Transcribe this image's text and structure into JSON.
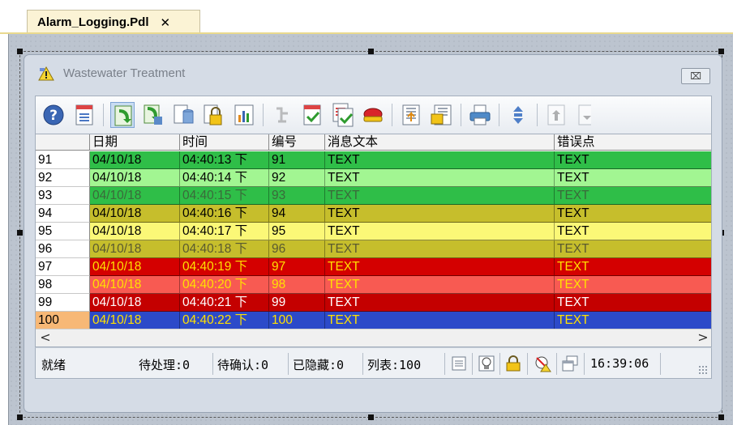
{
  "tab": {
    "title": "Alarm_Logging.Pdl",
    "close": "✕"
  },
  "window": {
    "title": "Wastewater Treatment",
    "close": "⌧"
  },
  "table": {
    "columns": [
      "",
      "日期",
      "时间",
      "编号",
      "消息文本",
      "错误点"
    ],
    "rows": [
      {
        "n": "91",
        "date": "04/10/18",
        "time": "04:40:13 下",
        "id": "91",
        "msg": "TEXT",
        "err": "TEXT",
        "bg": "#2fbe48",
        "fg": "#000000",
        "numbg": "#ffffff"
      },
      {
        "n": "92",
        "date": "04/10/18",
        "time": "04:40:14 下",
        "id": "92",
        "msg": "TEXT",
        "err": "TEXT",
        "bg": "#a2f692",
        "fg": "#000000",
        "numbg": "#ffffff"
      },
      {
        "n": "93",
        "date": "04/10/18",
        "time": "04:40:15 下",
        "id": "93",
        "msg": "TEXT",
        "err": "TEXT",
        "bg": "#2fbe48",
        "fg": "#3a6a3a",
        "numbg": "#ffffff"
      },
      {
        "n": "94",
        "date": "04/10/18",
        "time": "04:40:16 下",
        "id": "94",
        "msg": "TEXT",
        "err": "TEXT",
        "bg": "#c6be2c",
        "fg": "#000000",
        "numbg": "#ffffff"
      },
      {
        "n": "95",
        "date": "04/10/18",
        "time": "04:40:17 下",
        "id": "95",
        "msg": "TEXT",
        "err": "TEXT",
        "bg": "#fbf877",
        "fg": "#000000",
        "numbg": "#ffffff"
      },
      {
        "n": "96",
        "date": "04/10/18",
        "time": "04:40:18 下",
        "id": "96",
        "msg": "TEXT",
        "err": "TEXT",
        "bg": "#c6be2c",
        "fg": "#5a5a30",
        "numbg": "#ffffff"
      },
      {
        "n": "97",
        "date": "04/10/18",
        "time": "04:40:19 下",
        "id": "97",
        "msg": "TEXT",
        "err": "TEXT",
        "bg": "#d40000",
        "fg": "#ffe000",
        "numbg": "#ffffff"
      },
      {
        "n": "98",
        "date": "04/10/18",
        "time": "04:40:20 下",
        "id": "98",
        "msg": "TEXT",
        "err": "TEXT",
        "bg": "#f85a52",
        "fg": "#ffe000",
        "numbg": "#ffffff"
      },
      {
        "n": "99",
        "date": "04/10/18",
        "time": "04:40:21 下",
        "id": "99",
        "msg": "TEXT",
        "err": "TEXT",
        "bg": "#c40000",
        "fg": "#ffffff",
        "numbg": "#ffffff"
      },
      {
        "n": "100",
        "date": "04/10/18",
        "time": "04:40:22 下",
        "id": "100",
        "msg": "TEXT",
        "err": "TEXT",
        "bg": "#2c4ac9",
        "fg": "#ffe000",
        "numbg": "#f7b876"
      }
    ]
  },
  "scroll": {
    "left": "<",
    "right": ">"
  },
  "status": {
    "ready": "就绪",
    "pending": "待处理:0",
    "unack": "待确认:0",
    "hidden": "已隐藏:0",
    "list": "列表:100",
    "clock": "16:39:06"
  },
  "toolbar_icons": [
    "help-icon",
    "emergency-list-icon",
    "current-alarm-list-icon",
    "archive-list-icon",
    "history-list-icon",
    "lock-list-icon",
    "statistics-icon",
    "loop-in-alarm-icon",
    "single-acknowledge-icon",
    "group-acknowledge-icon",
    "horn-acknowledge-icon",
    "first-message-icon",
    "last-message-icon",
    "print-icon",
    "sort-icon",
    "select-top-icon",
    "select-bottom-icon"
  ]
}
